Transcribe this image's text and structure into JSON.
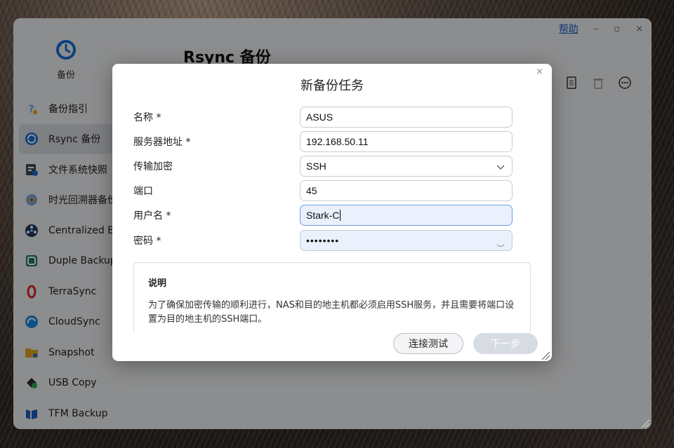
{
  "window": {
    "help_label": "帮助",
    "minimize_label": "–",
    "maximize_label": "▫",
    "close_label": "×"
  },
  "sidebar": {
    "app_label": "备份",
    "items": [
      {
        "label": "备份指引",
        "icon": "backup-guide-icon"
      },
      {
        "label": "Rsync 备份",
        "icon": "rsync-icon"
      },
      {
        "label": "文件系统快照",
        "icon": "snapshot-fs-icon"
      },
      {
        "label": "时光回溯器备份",
        "icon": "time-machine-icon"
      },
      {
        "label": "Centralized Backup",
        "icon": "centralized-icon"
      },
      {
        "label": "Duple Backup",
        "icon": "duple-icon"
      },
      {
        "label": "TerraSync",
        "icon": "terrasync-icon"
      },
      {
        "label": "CloudSync",
        "icon": "cloudsync-icon"
      },
      {
        "label": "Snapshot",
        "icon": "folder-icon"
      },
      {
        "label": "USB Copy",
        "icon": "usb-icon"
      },
      {
        "label": "TFM Backup",
        "icon": "tfm-icon"
      }
    ]
  },
  "main": {
    "title": "Rsync 备份"
  },
  "dialog": {
    "title": "新备份任务",
    "close_label": "×",
    "fields": {
      "name": {
        "label": "名称 *",
        "value": "ASUS"
      },
      "server": {
        "label": "服务器地址 *",
        "value": "192.168.50.11"
      },
      "encryption": {
        "label": "传输加密",
        "value": "SSH"
      },
      "port": {
        "label": "端口",
        "value": "45"
      },
      "username": {
        "label": "用户名 *",
        "value": "Stark-C"
      },
      "password": {
        "label": "密码 *",
        "value": "••••••••"
      }
    },
    "note": {
      "title": "说明",
      "text": "为了确保加密传输的顺利进行，NAS和目的地主机都必须启用SSH服务，并且需要将端口设置为目的地主机的SSH端口。"
    },
    "buttons": {
      "test": "连接测试",
      "next": "下一步"
    }
  },
  "colors": {
    "accent": "#1b63c6",
    "dim": "rgba(0,0,0,0.42)",
    "field_focus": "#eaf1fd"
  }
}
